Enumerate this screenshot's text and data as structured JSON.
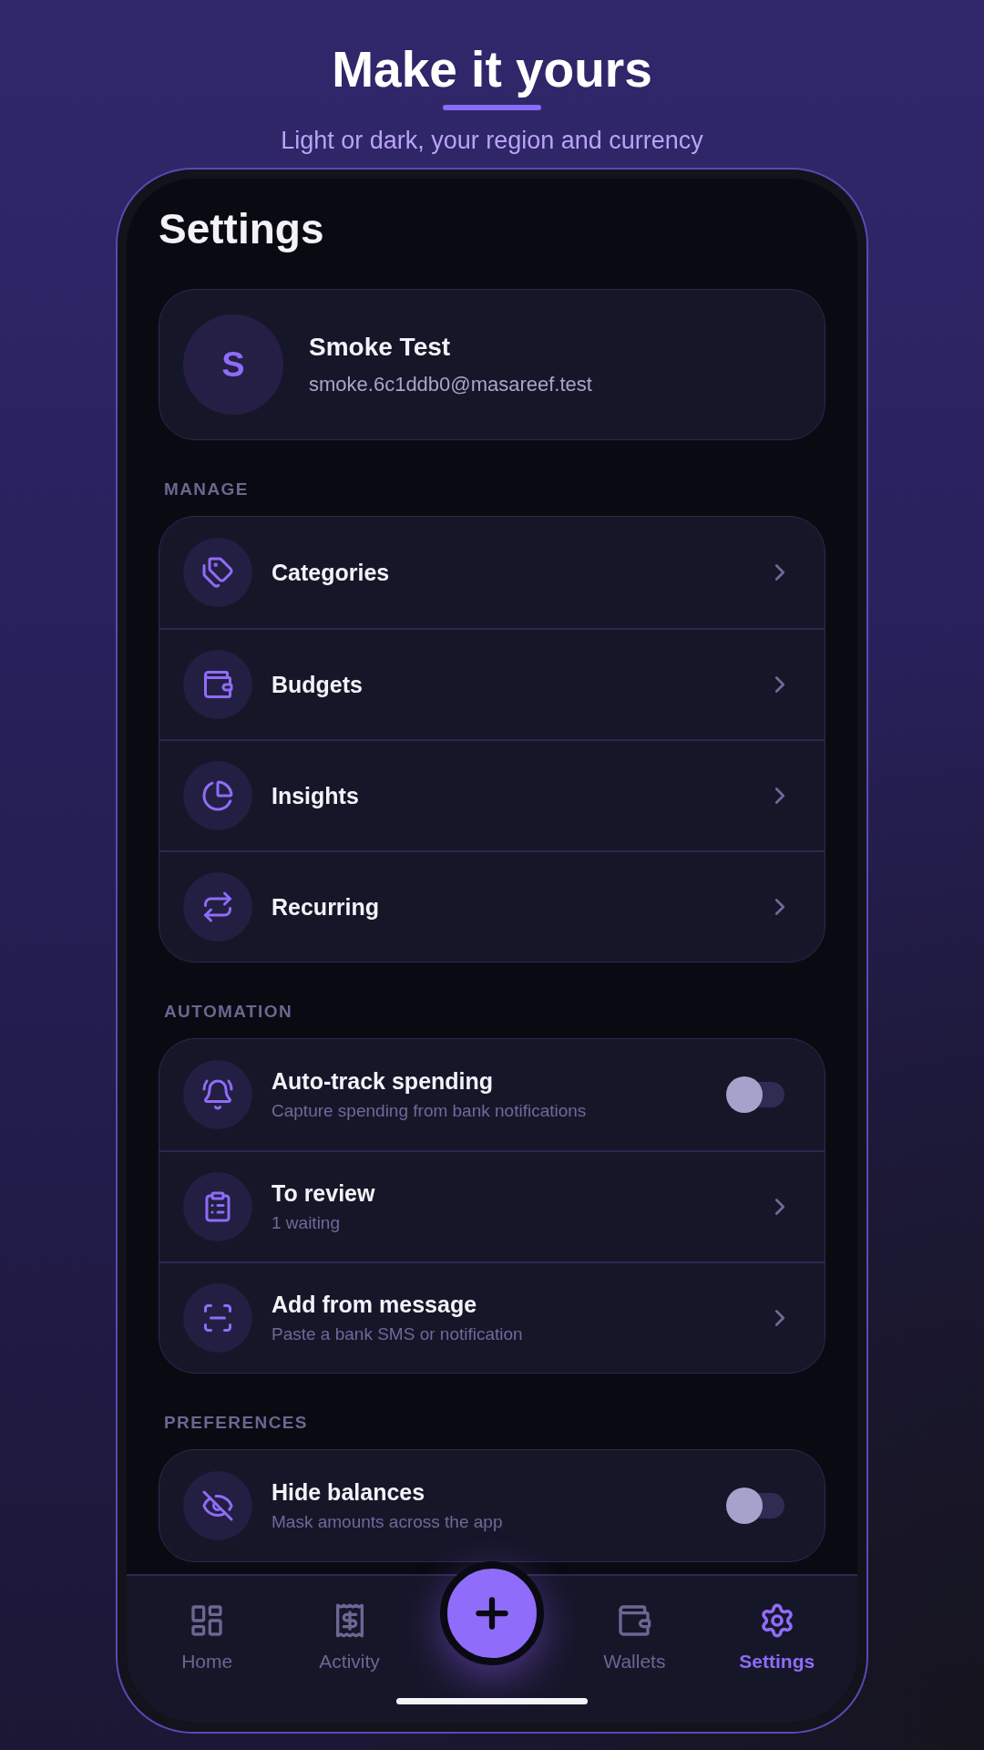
{
  "header": {
    "title": "Make it yours",
    "subtitle": "Light or dark, your region and currency"
  },
  "screen": {
    "title": "Settings",
    "profile": {
      "initial": "S",
      "name": "Smoke Test",
      "email": "smoke.6c1ddb0@masareef.test"
    },
    "sections": [
      {
        "label": "MANAGE",
        "rows": [
          {
            "kind": "link",
            "title": "Categories"
          },
          {
            "kind": "link",
            "title": "Budgets"
          },
          {
            "kind": "link",
            "title": "Insights"
          },
          {
            "kind": "link",
            "title": "Recurring"
          }
        ]
      },
      {
        "label": "AUTOMATION",
        "rows": [
          {
            "kind": "toggle",
            "title": "Auto-track spending",
            "subtitle": "Capture spending from bank notifications",
            "on": false
          },
          {
            "kind": "link",
            "title": "To review",
            "subtitle": "1 waiting"
          },
          {
            "kind": "link",
            "title": "Add from message",
            "subtitle": "Paste a bank SMS or notification"
          }
        ]
      },
      {
        "label": "PREFERENCES",
        "rows": [
          {
            "kind": "toggle",
            "title": "Hide balances",
            "subtitle": "Mask amounts across the app",
            "on": false
          }
        ]
      }
    ]
  },
  "nav": {
    "items": [
      {
        "label": "Home",
        "selected": false
      },
      {
        "label": "Activity",
        "selected": false
      },
      {
        "label": "Wallets",
        "selected": false
      },
      {
        "label": "Settings",
        "selected": true
      }
    ]
  }
}
